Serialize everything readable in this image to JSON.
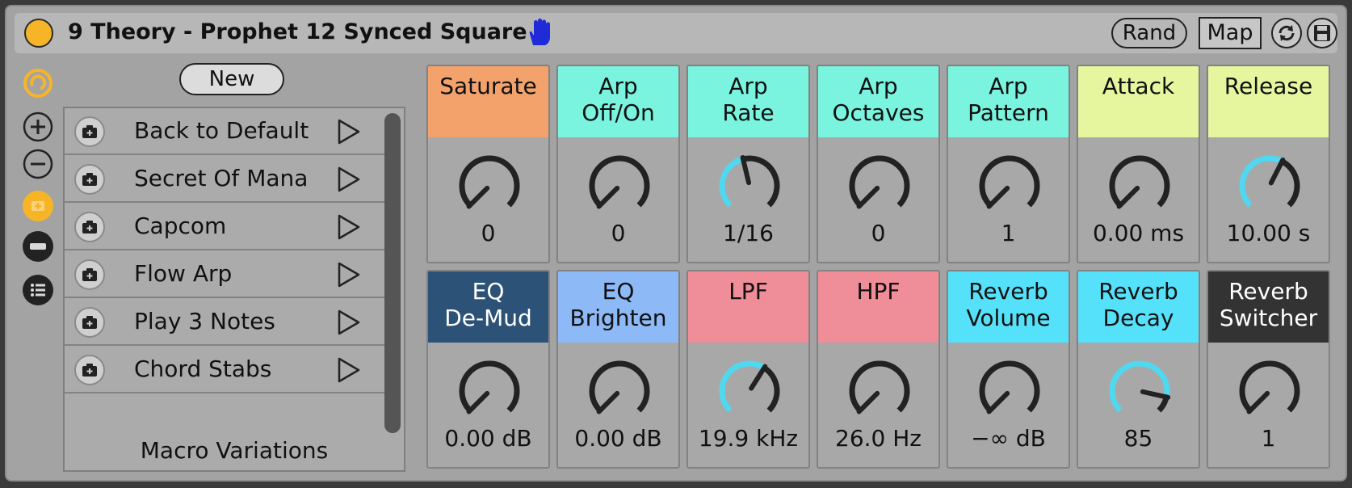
{
  "device": {
    "title": "9 Theory - Prophet 12 Synced Square",
    "rand_label": "Rand",
    "map_label": "Map"
  },
  "variations": {
    "new_label": "New",
    "footer": "Macro Variations",
    "items": [
      {
        "label": "Back to Default"
      },
      {
        "label": "Secret Of Mana"
      },
      {
        "label": "Capcom"
      },
      {
        "label": "Flow Arp"
      },
      {
        "label": "Play 3 Notes"
      },
      {
        "label": "Chord Stabs"
      }
    ]
  },
  "colors": {
    "accent_orange": "#f6b526",
    "knob_active": "#4fd8f0",
    "knob_track": "#222222"
  },
  "macros": [
    {
      "line1": "Saturate",
      "line2": "",
      "value": "0",
      "color": "#f3a26c",
      "text_color": "#111111",
      "level": 0.0
    },
    {
      "line1": "Arp",
      "line2": "Off/On",
      "value": "0",
      "color": "#7af4de",
      "text_color": "#111111",
      "level": 0.0
    },
    {
      "line1": "Arp",
      "line2": "Rate",
      "value": "1/16",
      "color": "#7af4de",
      "text_color": "#111111",
      "level": 0.45
    },
    {
      "line1": "Arp",
      "line2": "Octaves",
      "value": "0",
      "color": "#7af4de",
      "text_color": "#111111",
      "level": 0.0
    },
    {
      "line1": "Arp",
      "line2": "Pattern",
      "value": "1",
      "color": "#7af4de",
      "text_color": "#111111",
      "level": 0.0
    },
    {
      "line1": "Attack",
      "line2": "",
      "value": "0.00 ms",
      "color": "#e5f69e",
      "text_color": "#111111",
      "level": 0.0
    },
    {
      "line1": "Release",
      "line2": "",
      "value": "10.00 s",
      "color": "#e5f69e",
      "text_color": "#111111",
      "level": 0.6
    },
    {
      "line1": "EQ",
      "line2": "De-Mud",
      "value": "0.00 dB",
      "color": "#2c5377",
      "text_color": "#ffffff",
      "level": 0.0
    },
    {
      "line1": "EQ",
      "line2": "Brighten",
      "value": "0.00 dB",
      "color": "#8db9f7",
      "text_color": "#111111",
      "level": 0.0
    },
    {
      "line1": "LPF",
      "line2": "",
      "value": "19.9 kHz",
      "color": "#ef8d98",
      "text_color": "#111111",
      "level": 0.62
    },
    {
      "line1": "HPF",
      "line2": "",
      "value": "26.0 Hz",
      "color": "#ef8d98",
      "text_color": "#111111",
      "level": 0.0
    },
    {
      "line1": "Reverb",
      "line2": "Volume",
      "value": "−∞ dB",
      "color": "#56e1fb",
      "text_color": "#111111",
      "level": 0.0
    },
    {
      "line1": "Reverb",
      "line2": "Decay",
      "value": "85",
      "color": "#56e1fb",
      "text_color": "#111111",
      "level": 0.88
    },
    {
      "line1": "Reverb",
      "line2": "Switcher",
      "value": "1",
      "color": "#333333",
      "text_color": "#ffffff",
      "level": 0.0
    }
  ]
}
